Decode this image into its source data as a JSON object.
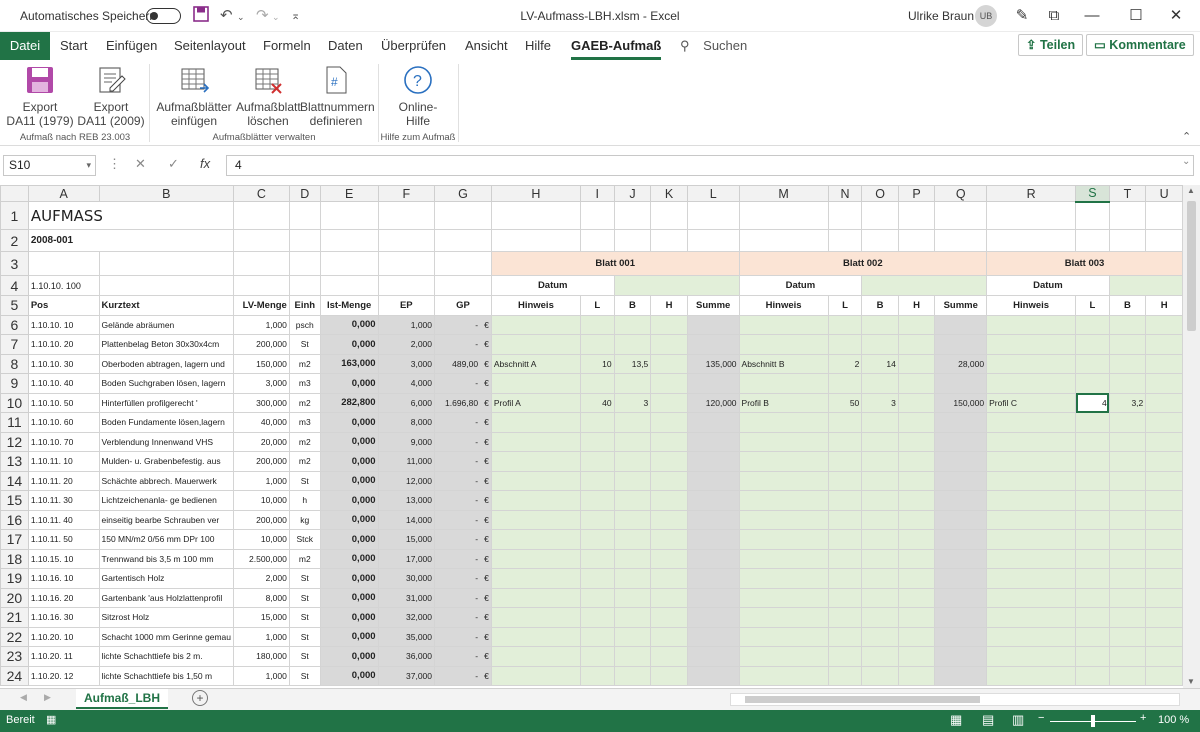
{
  "titlebar": {
    "autosave_label": "Automatisches Speichern",
    "window_title": "LV-Aufmass-LBH.xlsm  -  Excel",
    "user_name": "Ulrike Braun",
    "user_initials": "UB"
  },
  "tabs": [
    "Datei",
    "Start",
    "Einfügen",
    "Seitenlayout",
    "Formeln",
    "Daten",
    "Überprüfen",
    "Ansicht",
    "Hilfe",
    "GAEB-Aufmaß"
  ],
  "search_label": "Suchen",
  "share_label": "Teilen",
  "comments_label": "Kommentare",
  "ribbon": {
    "export1979_line1": "Export",
    "export1979_line2": "DA11 (1979)",
    "export2009_line1": "Export",
    "export2009_line2": "DA11 (2009)",
    "insert_line1": "Aufmaßblätter",
    "insert_line2": "einfügen",
    "delete_line1": "Aufmaßblatt",
    "delete_line2": "löschen",
    "define_line1": "Blattnummern",
    "define_line2": "definieren",
    "help_line1": "Online-",
    "help_line2": "Hilfe",
    "group1": "Aufmaß nach REB 23.003",
    "group2": "Aufmaßblätter verwalten",
    "group3": "Hilfe zum Aufmaß"
  },
  "formula_bar": {
    "name_box": "S10",
    "value": "4"
  },
  "columns": [
    "A",
    "B",
    "C",
    "D",
    "E",
    "F",
    "G",
    "H",
    "I",
    "J",
    "K",
    "L",
    "M",
    "N",
    "O",
    "P",
    "Q",
    "R",
    "S",
    "T",
    "U"
  ],
  "sheet": {
    "title": "AUFMASS",
    "project": "2008-001",
    "a4": "1.10.10. 100",
    "headers": {
      "pos": "Pos",
      "kurz": "Kurztext",
      "lvmenge": "LV-Menge",
      "einh": "Einh",
      "ist": "Ist-Menge",
      "ep": "EP",
      "gp": "GP"
    },
    "blatt1": "Blatt 001",
    "blatt2": "Blatt 002",
    "blatt3": "Blatt 003",
    "datum": "Datum",
    "hinweis": "Hinweis",
    "l": "L",
    "b": "B",
    "h": "H",
    "summe": "Summe"
  },
  "rows": [
    {
      "n": "6",
      "pos": "1.10.10. 10",
      "kurz": "Gelände abräumen",
      "lv": "1,000",
      "einh": "psch",
      "ist": "0,000",
      "ep": "1,000",
      "gp": "-",
      "eur": "€",
      "m1": [
        "",
        "",
        "",
        "",
        ""
      ],
      "m2": [
        "",
        "",
        "",
        "",
        ""
      ],
      "m3": [
        "",
        "",
        ""
      ]
    },
    {
      "n": "7",
      "pos": "1.10.10. 20",
      "kurz": "Plattenbelag Beton 30x30x4cm",
      "lv": "200,000",
      "einh": "St",
      "ist": "0,000",
      "ep": "2,000",
      "gp": "-",
      "eur": "€",
      "m1": [
        "",
        "",
        "",
        "",
        ""
      ],
      "m2": [
        "",
        "",
        "",
        "",
        ""
      ],
      "m3": [
        "",
        "",
        ""
      ]
    },
    {
      "n": "8",
      "pos": "1.10.10. 30",
      "kurz": "Oberboden abtragen, lagern und",
      "lv": "150,000",
      "einh": "m2",
      "ist": "163,000",
      "ep": "3,000",
      "gp": "489,00",
      "eur": "€",
      "m1": [
        "Abschnitt A",
        "10",
        "13,5",
        "",
        "135,000"
      ],
      "m2": [
        "Abschnitt B",
        "2",
        "14",
        "",
        "28,000"
      ],
      "m3": [
        "",
        "",
        ""
      ]
    },
    {
      "n": "9",
      "pos": "1.10.10. 40",
      "kurz": "Boden Suchgraben lösen, lagern",
      "lv": "3,000",
      "einh": "m3",
      "ist": "0,000",
      "ep": "4,000",
      "gp": "-",
      "eur": "€",
      "m1": [
        "",
        "",
        "",
        "",
        ""
      ],
      "m2": [
        "",
        "",
        "",
        "",
        ""
      ],
      "m3": [
        "",
        "",
        ""
      ]
    },
    {
      "n": "10",
      "pos": "1.10.10. 50",
      "kurz": "Hinterfüllen profilgerecht '",
      "lv": "300,000",
      "einh": "m2",
      "ist": "282,800",
      "ep": "6,000",
      "gp": "1.696,80",
      "eur": "€",
      "m1": [
        "Profil A",
        "40",
        "3",
        "",
        "120,000"
      ],
      "m2": [
        "Profil B",
        "50",
        "3",
        "",
        "150,000"
      ],
      "m3": [
        "Profil C",
        "4",
        "3,2"
      ]
    },
    {
      "n": "11",
      "pos": "1.10.10. 60",
      "kurz": "Boden Fundamente lösen,lagern",
      "lv": "40,000",
      "einh": "m3",
      "ist": "0,000",
      "ep": "8,000",
      "gp": "-",
      "eur": "€",
      "m1": [
        "",
        "",
        "",
        "",
        ""
      ],
      "m2": [
        "",
        "",
        "",
        "",
        ""
      ],
      "m3": [
        "",
        "",
        ""
      ]
    },
    {
      "n": "12",
      "pos": "1.10.10. 70",
      "kurz": "Verblendung Innenwand VHS",
      "lv": "20,000",
      "einh": "m2",
      "ist": "0,000",
      "ep": "9,000",
      "gp": "-",
      "eur": "€",
      "m1": [
        "",
        "",
        "",
        "",
        ""
      ],
      "m2": [
        "",
        "",
        "",
        "",
        ""
      ],
      "m3": [
        "",
        "",
        ""
      ]
    },
    {
      "n": "13",
      "pos": "1.10.11. 10",
      "kurz": "Mulden- u. Grabenbefestig. aus",
      "lv": "200,000",
      "einh": "m2",
      "ist": "0,000",
      "ep": "11,000",
      "gp": "-",
      "eur": "€",
      "m1": [
        "",
        "",
        "",
        "",
        ""
      ],
      "m2": [
        "",
        "",
        "",
        "",
        ""
      ],
      "m3": [
        "",
        "",
        ""
      ]
    },
    {
      "n": "14",
      "pos": "1.10.11. 20",
      "kurz": "Schächte abbrech. Mauerwerk",
      "lv": "1,000",
      "einh": "St",
      "ist": "0,000",
      "ep": "12,000",
      "gp": "-",
      "eur": "€",
      "m1": [
        "",
        "",
        "",
        "",
        ""
      ],
      "m2": [
        "",
        "",
        "",
        "",
        ""
      ],
      "m3": [
        "",
        "",
        ""
      ]
    },
    {
      "n": "15",
      "pos": "1.10.11. 30",
      "kurz": "Lichtzeichenanla- ge bedienen",
      "lv": "10,000",
      "einh": "h",
      "ist": "0,000",
      "ep": "13,000",
      "gp": "-",
      "eur": "€",
      "m1": [
        "",
        "",
        "",
        "",
        ""
      ],
      "m2": [
        "",
        "",
        "",
        "",
        ""
      ],
      "m3": [
        "",
        "",
        ""
      ]
    },
    {
      "n": "16",
      "pos": "1.10.11. 40",
      "kurz": "einseitig bearbe Schrauben ver",
      "lv": "200,000",
      "einh": "kg",
      "ist": "0,000",
      "ep": "14,000",
      "gp": "-",
      "eur": "€",
      "m1": [
        "",
        "",
        "",
        "",
        ""
      ],
      "m2": [
        "",
        "",
        "",
        "",
        ""
      ],
      "m3": [
        "",
        "",
        ""
      ]
    },
    {
      "n": "17",
      "pos": "1.10.11. 50",
      "kurz": "150 MN/m2 0/56 mm DPr 100",
      "lv": "10,000",
      "einh": "Stck",
      "ist": "0,000",
      "ep": "15,000",
      "gp": "-",
      "eur": "€",
      "m1": [
        "",
        "",
        "",
        "",
        ""
      ],
      "m2": [
        "",
        "",
        "",
        "",
        ""
      ],
      "m3": [
        "",
        "",
        ""
      ]
    },
    {
      "n": "18",
      "pos": "1.10.15. 10",
      "kurz": "Trennwand bis 3,5 m 100 mm",
      "lv": "2.500,000",
      "einh": "m2",
      "ist": "0,000",
      "ep": "17,000",
      "gp": "-",
      "eur": "€",
      "m1": [
        "",
        "",
        "",
        "",
        ""
      ],
      "m2": [
        "",
        "",
        "",
        "",
        ""
      ],
      "m3": [
        "",
        "",
        ""
      ]
    },
    {
      "n": "19",
      "pos": "1.10.16. 10",
      "kurz": "Gartentisch Holz",
      "lv": "2,000",
      "einh": "St",
      "ist": "0,000",
      "ep": "30,000",
      "gp": "-",
      "eur": "€",
      "m1": [
        "",
        "",
        "",
        "",
        ""
      ],
      "m2": [
        "",
        "",
        "",
        "",
        ""
      ],
      "m3": [
        "",
        "",
        ""
      ]
    },
    {
      "n": "20",
      "pos": "1.10.16. 20",
      "kurz": "Gartenbank 'aus Holzlattenprofil",
      "lv": "8,000",
      "einh": "St",
      "ist": "0,000",
      "ep": "31,000",
      "gp": "-",
      "eur": "€",
      "m1": [
        "",
        "",
        "",
        "",
        ""
      ],
      "m2": [
        "",
        "",
        "",
        "",
        ""
      ],
      "m3": [
        "",
        "",
        ""
      ]
    },
    {
      "n": "21",
      "pos": "1.10.16. 30",
      "kurz": "Sitzrost Holz",
      "lv": "15,000",
      "einh": "St",
      "ist": "0,000",
      "ep": "32,000",
      "gp": "-",
      "eur": "€",
      "m1": [
        "",
        "",
        "",
        "",
        ""
      ],
      "m2": [
        "",
        "",
        "",
        "",
        ""
      ],
      "m3": [
        "",
        "",
        ""
      ]
    },
    {
      "n": "22",
      "pos": "1.10.20. 10",
      "kurz": "Schacht 1000 mm Gerinne gemau",
      "lv": "1,000",
      "einh": "St",
      "ist": "0,000",
      "ep": "35,000",
      "gp": "-",
      "eur": "€",
      "m1": [
        "",
        "",
        "",
        "",
        ""
      ],
      "m2": [
        "",
        "",
        "",
        "",
        ""
      ],
      "m3": [
        "",
        "",
        ""
      ]
    },
    {
      "n": "23",
      "pos": "1.10.20. 11",
      "kurz": "lichte Schachttiefe bis 2 m.",
      "lv": "180,000",
      "einh": "St",
      "ist": "0,000",
      "ep": "36,000",
      "gp": "-",
      "eur": "€",
      "m1": [
        "",
        "",
        "",
        "",
        ""
      ],
      "m2": [
        "",
        "",
        "",
        "",
        ""
      ],
      "m3": [
        "",
        "",
        ""
      ]
    },
    {
      "n": "24",
      "pos": "1.10.20. 12",
      "kurz": "lichte Schachttiefe bis 1,50 m",
      "lv": "1,000",
      "einh": "St",
      "ist": "0,000",
      "ep": "37,000",
      "gp": "-",
      "eur": "€",
      "m1": [
        "",
        "",
        "",
        "",
        ""
      ],
      "m2": [
        "",
        "",
        "",
        "",
        ""
      ],
      "m3": [
        "",
        "",
        ""
      ]
    }
  ],
  "sheet_tab": "Aufmaß_LBH",
  "status": {
    "ready": "Bereit",
    "zoom": "100 %"
  },
  "colors": {
    "excel_green": "#217346",
    "entry_green": "#e2efd9",
    "header_orange": "#fbe4d5",
    "sum_gray": "#d9d9d9"
  },
  "icons": [
    "save-icon",
    "undo-icon",
    "redo-icon",
    "customize-qat-icon",
    "pen-icon",
    "ribbon-display-icon",
    "minimize-icon",
    "maximize-icon",
    "close-icon",
    "search-icon",
    "export-icon",
    "insert-sheets-icon",
    "delete-sheet-icon",
    "number-sheets-icon",
    "help-icon",
    "fx-icon"
  ]
}
